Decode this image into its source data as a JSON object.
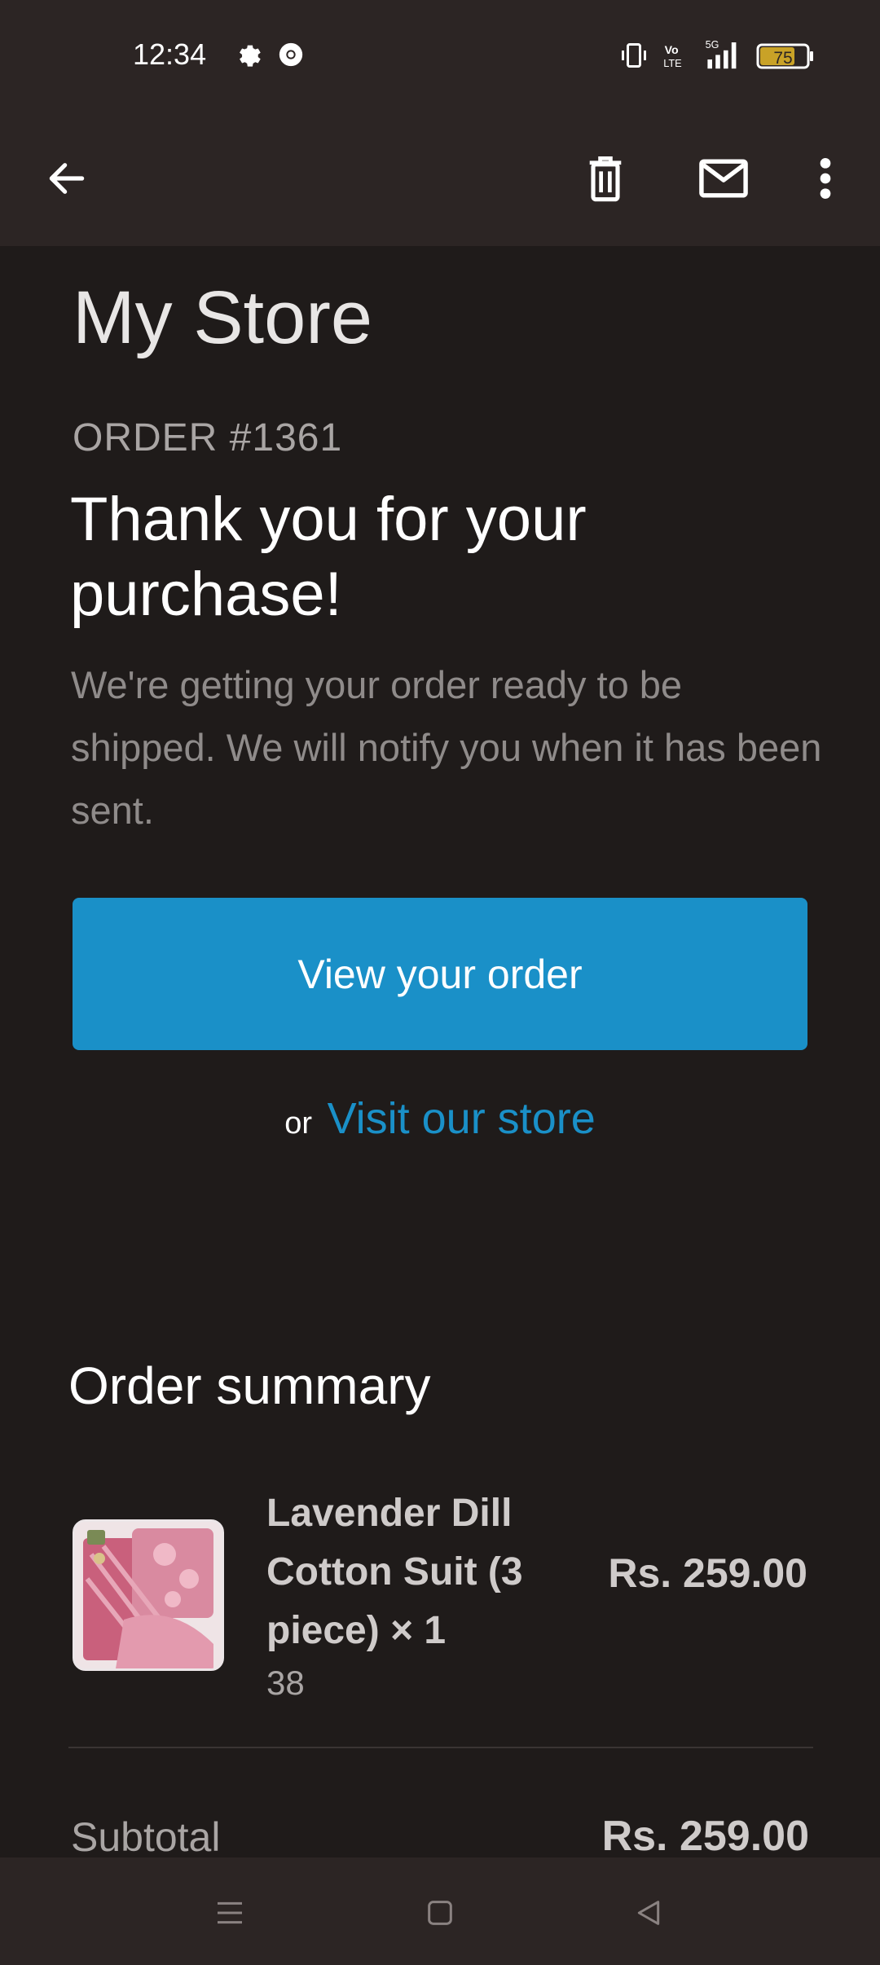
{
  "status_bar": {
    "time": "12:34",
    "battery_level": "75",
    "network": "5G",
    "icons": [
      "settings-icon",
      "chrome-icon",
      "vibrate-icon",
      "volte-icon",
      "signal-icon",
      "battery-icon"
    ]
  },
  "app_bar": {
    "icons": [
      "back-arrow-icon",
      "delete-icon",
      "mail-icon",
      "more-vert-icon"
    ]
  },
  "email": {
    "store_name": "My Store",
    "order_number": "ORDER #1361",
    "headline": "Thank you for your purchase!",
    "message": "We're getting your order ready to be shipped. We will notify you when it has been sent.",
    "view_order_label": "View your order",
    "or_text": "or",
    "visit_store_label": "Visit our store",
    "summary_title": "Order summary",
    "item": {
      "name": "Lavender Dill Cotton Suit (3 piece) × 1",
      "variant": "38",
      "price": "Rs. 259.00"
    },
    "subtotal_label": "Subtotal",
    "subtotal_value": "Rs. 259.00"
  },
  "colors": {
    "accent": "#1a90c8",
    "background": "#1f1b1a",
    "bars": "#2c2524"
  },
  "nav_bar": {
    "icons": [
      "menu-icon",
      "home-icon",
      "back-icon"
    ]
  }
}
